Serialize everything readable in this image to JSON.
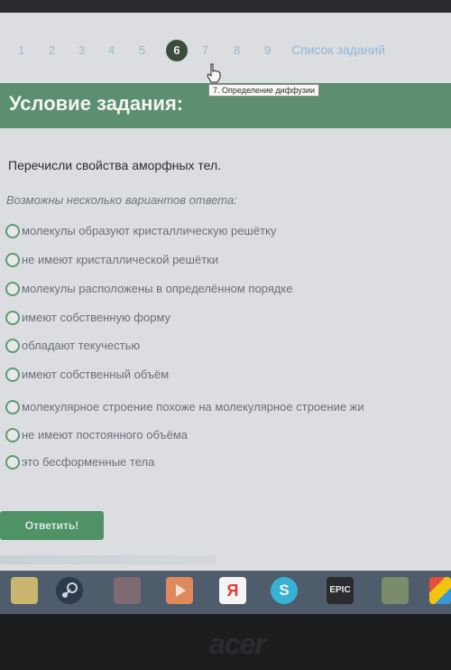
{
  "pager": {
    "pages": [
      "1",
      "2",
      "3",
      "4",
      "5",
      "6",
      "7",
      "8",
      "9"
    ],
    "active_page": "6",
    "task_list_link": "Список заданий",
    "tooltip": "7. Определение диффузии"
  },
  "banner": {
    "title": "Условие задания:"
  },
  "task": {
    "question": "Перечисли свойства аморфных тел.",
    "hint": "Возможны несколько вариантов ответа:",
    "options": [
      "молекулы образуют кристаллическую решётку",
      "не имеют кристаллической решётки",
      "молекулы расположены в определённом порядке",
      "имеют собственную форму",
      "обладают текучестью",
      "имеют собственный объём",
      "молекулярное строение похоже на молекулярное строение жи",
      "не имеют постоянного объёма",
      "это бесформенные тела"
    ],
    "submit_label": "Ответить!"
  },
  "taskbar": {
    "icons": [
      "file-manager-icon",
      "steam-icon",
      "app-icon",
      "media-player-icon",
      "yandex-browser-icon",
      "skype-icon",
      "epic-games-icon",
      "minecraft-icon",
      "rubiks-cube-icon"
    ],
    "yandex_label": "Я",
    "skype_label": "S",
    "epic_label": "EPIC"
  },
  "bezel": {
    "brand": "acer"
  }
}
